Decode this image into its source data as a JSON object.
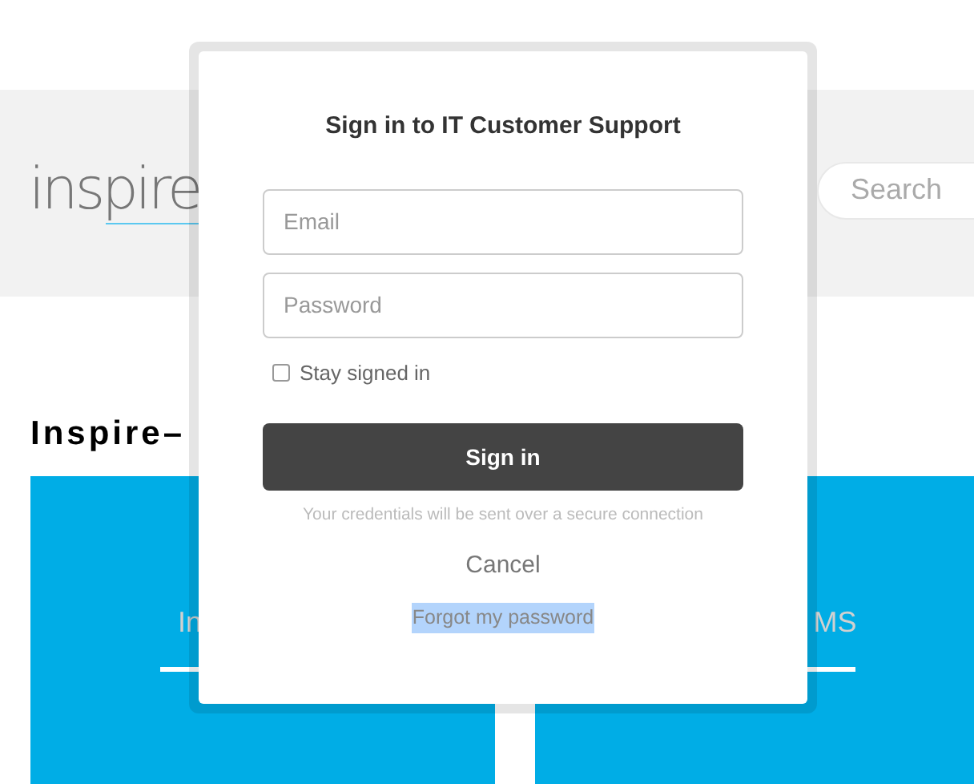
{
  "header": {
    "logo": "inspire",
    "search": {
      "placeholder": "Search"
    }
  },
  "heading": "Inspire–",
  "tiles": [
    {
      "label": "In"
    },
    {
      "label": "MS"
    }
  ],
  "dialog": {
    "title": "Sign in to IT Customer Support",
    "email": {
      "placeholder": "Email"
    },
    "password": {
      "placeholder": "Password"
    },
    "stay_signed_in": {
      "label": "Stay signed in",
      "checked": false
    },
    "sign_in_button": "Sign in",
    "note": "Your credentials will be sent over a secure connection",
    "cancel": "Cancel",
    "forgot": {
      "label": "Forgot my password",
      "highlighted": true
    }
  }
}
